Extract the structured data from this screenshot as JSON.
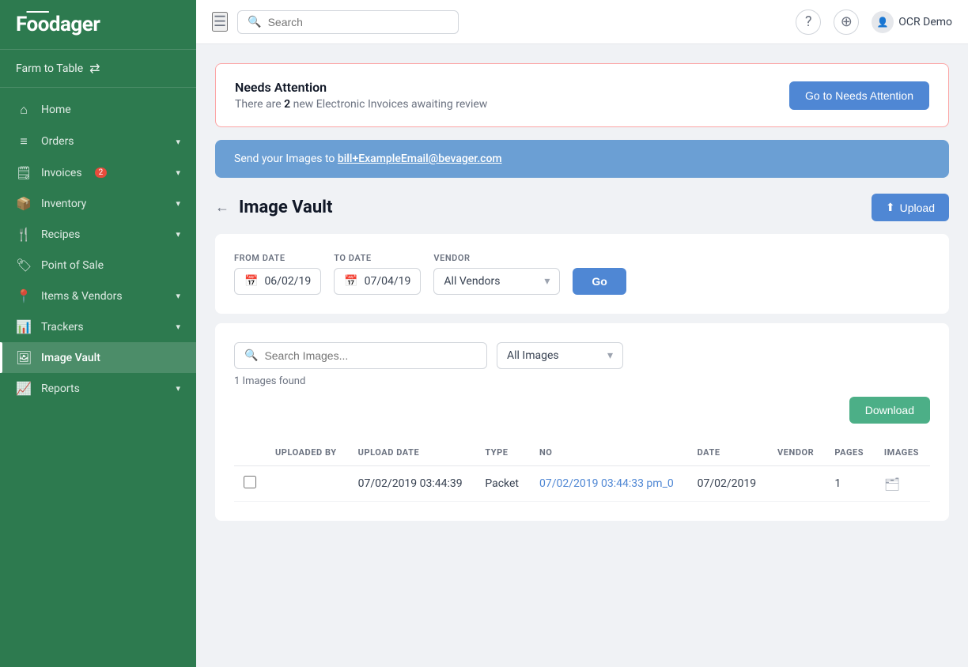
{
  "sidebar": {
    "logo": "Foodager",
    "org": {
      "name": "Farm to Table",
      "icon": "⇄"
    },
    "items": [
      {
        "id": "home",
        "label": "Home",
        "icon": "⌂",
        "active": false,
        "badge": null,
        "chevron": false
      },
      {
        "id": "orders",
        "label": "Orders",
        "icon": "☰",
        "active": false,
        "badge": null,
        "chevron": true
      },
      {
        "id": "invoices",
        "label": "Invoices",
        "icon": "📄",
        "active": false,
        "badge": "2",
        "chevron": true
      },
      {
        "id": "inventory",
        "label": "Inventory",
        "icon": "📦",
        "active": false,
        "badge": null,
        "chevron": true
      },
      {
        "id": "recipes",
        "label": "Recipes",
        "icon": "🍴",
        "active": false,
        "badge": null,
        "chevron": true
      },
      {
        "id": "pos",
        "label": "Point of Sale",
        "icon": "🏷",
        "active": false,
        "badge": null,
        "chevron": false
      },
      {
        "id": "items-vendors",
        "label": "Items & Vendors",
        "icon": "📍",
        "active": false,
        "badge": null,
        "chevron": true
      },
      {
        "id": "trackers",
        "label": "Trackers",
        "icon": "📊",
        "active": false,
        "badge": null,
        "chevron": true
      },
      {
        "id": "image-vault",
        "label": "Image Vault",
        "icon": "🖼",
        "active": true,
        "badge": null,
        "chevron": false
      },
      {
        "id": "reports",
        "label": "Reports",
        "icon": "📈",
        "active": false,
        "badge": null,
        "chevron": true
      }
    ]
  },
  "topbar": {
    "search_placeholder": "Search",
    "user_name": "OCR Demo"
  },
  "needs_attention": {
    "title": "Needs Attention",
    "count": "2",
    "message_prefix": "There are ",
    "message_suffix": " new Electronic Invoices awaiting review",
    "button_label": "Go to Needs Attention"
  },
  "email_banner": {
    "prefix": "Send your Images to ",
    "email": "bill+ExampleEmail@bevager.com"
  },
  "page": {
    "title": "Image Vault",
    "upload_label": "Upload"
  },
  "filters": {
    "from_date_label": "FROM DATE",
    "from_date_value": "06/02/19",
    "to_date_label": "TO DATE",
    "to_date_value": "07/04/19",
    "vendor_label": "VENDOR",
    "vendor_value": "All Vendors",
    "go_label": "Go"
  },
  "images_section": {
    "search_placeholder": "Search Images...",
    "type_value": "All Images",
    "images_found": "1 Images found",
    "download_label": "Download",
    "table": {
      "columns": [
        "",
        "UPLOADED BY",
        "UPLOAD DATE",
        "TYPE",
        "NO",
        "DATE",
        "VENDOR",
        "PAGES",
        "IMAGES"
      ],
      "rows": [
        {
          "checkbox": false,
          "uploaded_by": "",
          "upload_date": "07/02/2019 03:44:39",
          "type": "Packet",
          "no": "07/02/2019 03:44:33 pm_0",
          "date": "07/02/2019",
          "vendor": "",
          "pages": "1",
          "images": "folder"
        }
      ]
    }
  }
}
